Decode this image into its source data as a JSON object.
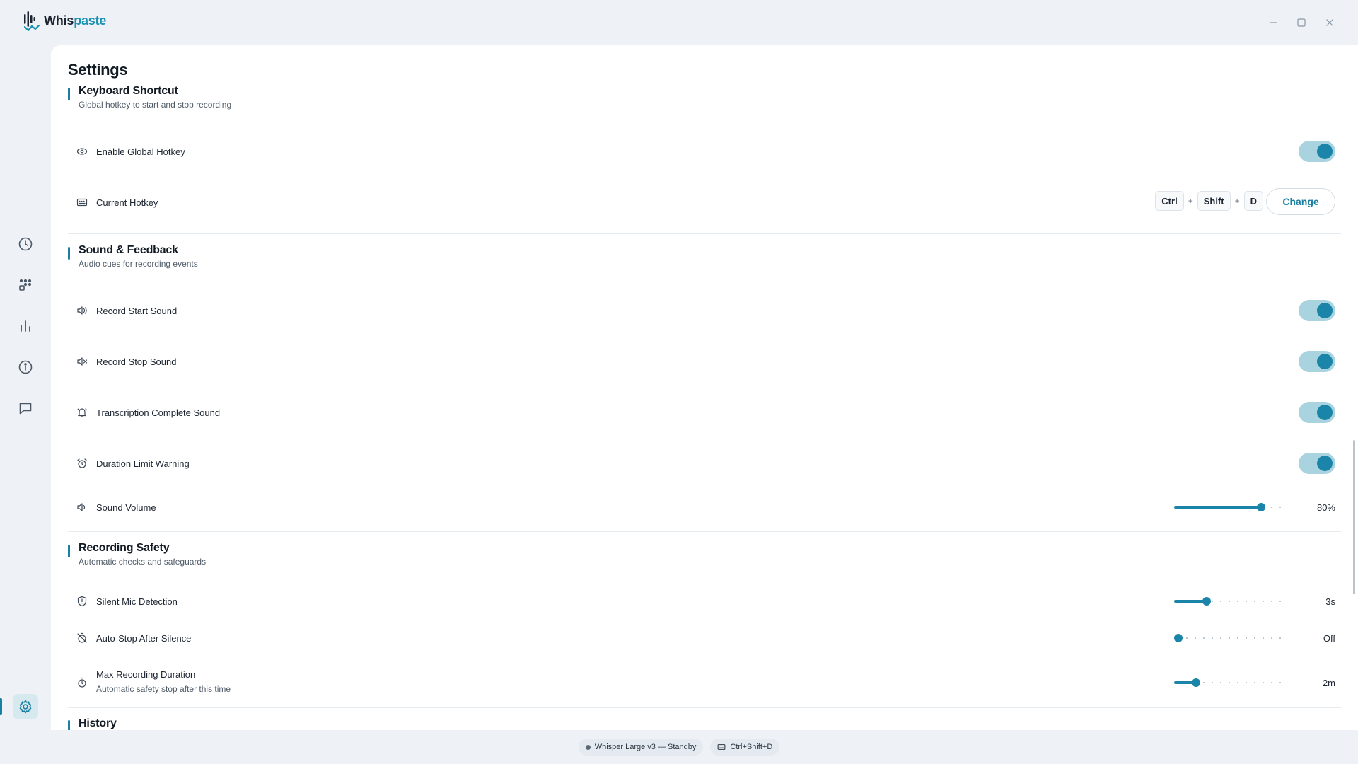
{
  "app": {
    "name_part1": "Whis",
    "name_part2": "paste"
  },
  "page": {
    "title": "Settings"
  },
  "sections": {
    "keyboard": {
      "title": "Keyboard Shortcut",
      "subtitle": "Global hotkey to start and stop recording",
      "enable_label": "Enable Global Hotkey",
      "enable_on": true,
      "hotkey_label": "Current Hotkey",
      "keys": [
        "Ctrl",
        "Shift",
        "D"
      ],
      "plus": "+",
      "change_label": "Change"
    },
    "sound": {
      "title": "Sound & Feedback",
      "subtitle": "Audio cues for recording events",
      "rows": [
        {
          "label": "Record Start Sound",
          "on": true
        },
        {
          "label": "Record Stop Sound",
          "on": true
        },
        {
          "label": "Transcription Complete Sound",
          "on": true
        },
        {
          "label": "Duration Limit Warning",
          "on": true
        }
      ],
      "volume_label": "Sound Volume",
      "volume_value": "80%",
      "volume_fraction": 0.8
    },
    "safety": {
      "title": "Recording Safety",
      "subtitle": "Automatic checks and safeguards",
      "silent_label": "Silent Mic Detection",
      "silent_value": "3s",
      "silent_fraction": 0.3,
      "autostop_label": "Auto-Stop After Silence",
      "autostop_value": "Off",
      "autostop_fraction": 0,
      "max_label": "Max Recording Duration",
      "max_sublabel": "Automatic safety stop after this time",
      "max_value": "2m",
      "max_fraction": 0.2
    },
    "history": {
      "title": "History"
    }
  },
  "statusbar": {
    "model_status": "Whisper Large v3 — Standby",
    "hotkey": "Ctrl+Shift+D"
  },
  "colors": {
    "accent": "#1a85a8",
    "toggle_track": "#a9d3df"
  }
}
